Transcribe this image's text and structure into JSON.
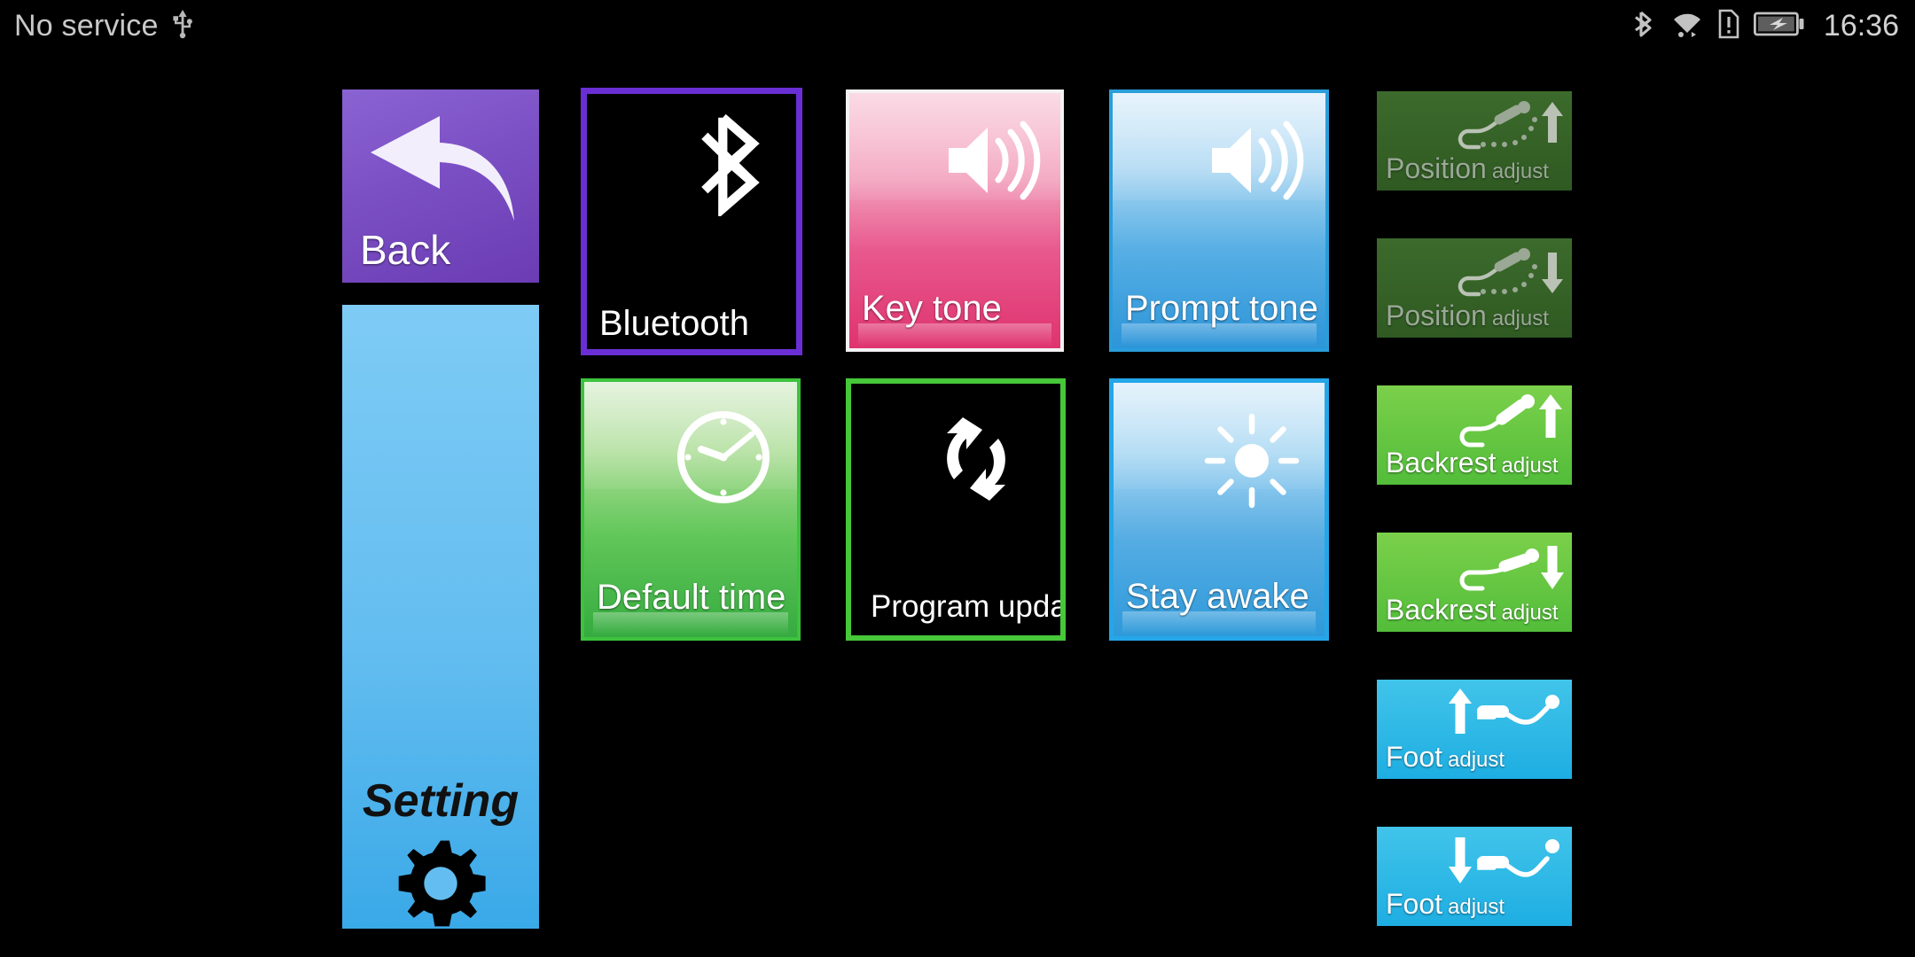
{
  "statusbar": {
    "carrier": "No service",
    "usb_icon": "usb-icon",
    "bluetooth_icon": "bluetooth-icon",
    "wifi_icon": "wifi-icon",
    "sim_alert_icon": "sim-card-alert-icon",
    "battery_icon": "battery-charging-icon",
    "time": "16:36"
  },
  "nav": {
    "back_label": "Back",
    "back_icon": "back-arrow-icon",
    "back_color": "#7b4fc4",
    "setting_label": "Setting",
    "setting_icon": "gear-icon",
    "setting_color": "#63bdf0"
  },
  "grid": {
    "tiles": [
      {
        "label": "Bluetooth",
        "icon": "bluetooth-icon",
        "accent": "#6a2fd4",
        "state": "enabled"
      },
      {
        "label": "Key tone",
        "icon": "speaker-volume-icon",
        "accent": "#df336f",
        "state": "enabled"
      },
      {
        "label": "Prompt tone",
        "icon": "speaker-volume-icon",
        "accent": "#2d95d9",
        "state": "enabled"
      },
      {
        "label": "Default time",
        "icon": "clock-icon",
        "accent": "#35ab3f",
        "state": "enabled"
      },
      {
        "label": "Program update",
        "icon": "refresh-sync-icon",
        "accent": "#47c73a",
        "state": "enabled"
      },
      {
        "label": "Stay awake",
        "icon": "sun-brightness-icon",
        "accent": "#2e9ada",
        "state": "enabled"
      }
    ]
  },
  "adjust": {
    "buttons": [
      {
        "main": "Position",
        "sub": "adjust",
        "icon": "person-recline-up-icon",
        "color": "#2f5a22",
        "state": "disabled"
      },
      {
        "main": "Position",
        "sub": "adjust",
        "icon": "person-recline-down-icon",
        "color": "#2f5a22",
        "state": "disabled"
      },
      {
        "main": "Backrest",
        "sub": "adjust",
        "icon": "backrest-up-icon",
        "color": "#52bd3a",
        "state": "enabled"
      },
      {
        "main": "Backrest",
        "sub": "adjust",
        "icon": "backrest-down-icon",
        "color": "#52bd3a",
        "state": "enabled"
      },
      {
        "main": "Foot",
        "sub": "adjust",
        "icon": "foot-up-icon",
        "color": "#1eaee2",
        "state": "enabled"
      },
      {
        "main": "Foot",
        "sub": "adjust",
        "icon": "foot-down-icon",
        "color": "#1eaee2",
        "state": "enabled"
      }
    ]
  }
}
